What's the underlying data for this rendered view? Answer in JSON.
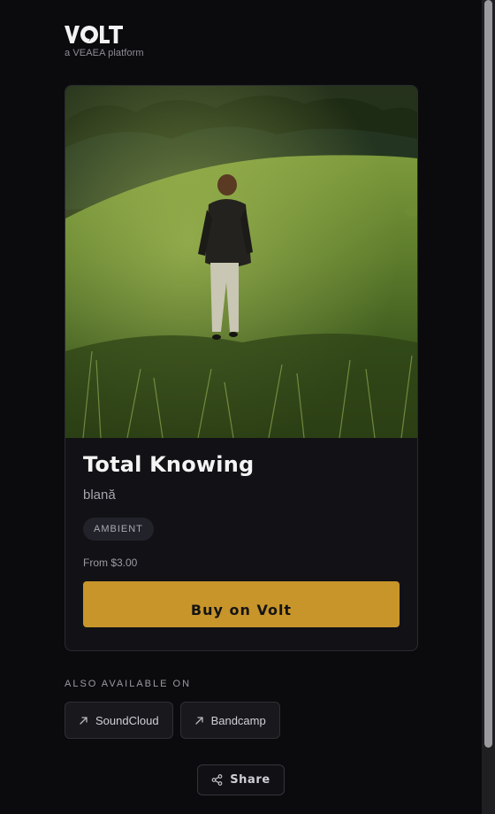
{
  "brand": {
    "logo_text": "VOLT",
    "tagline": "a VEAEA platform"
  },
  "release": {
    "cover_icon": "album-cover-image",
    "title": "Total Knowing",
    "artist": "blană",
    "genre_tag": "AMBIENT",
    "price": "From $3.00",
    "buy_label": "Buy on Volt"
  },
  "also_available": {
    "heading": "ALSO AVAILABLE ON",
    "links": [
      {
        "label": "SoundCloud",
        "icon": "arrow-up-right-icon"
      },
      {
        "label": "Bandcamp",
        "icon": "arrow-up-right-icon"
      }
    ]
  },
  "share": {
    "label": "Share",
    "icon": "share-icon"
  },
  "colors": {
    "background": "#0b0b0d",
    "card": "#121216",
    "accent": "#c8952b"
  }
}
